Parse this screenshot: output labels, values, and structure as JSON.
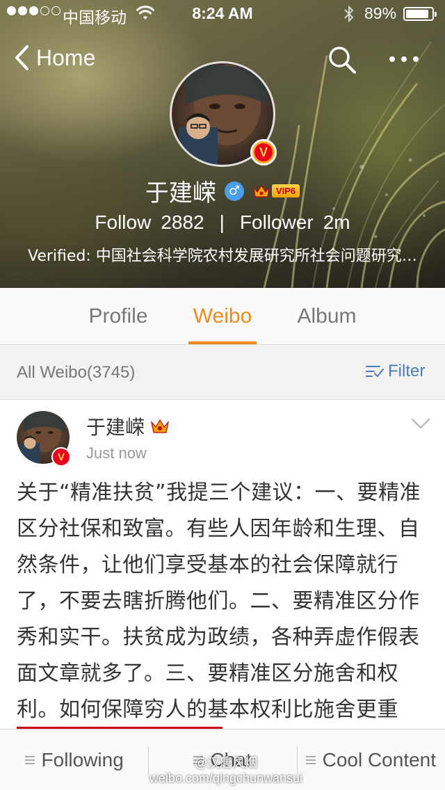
{
  "status_bar": {
    "carrier": "中国移动",
    "time": "8:24 AM",
    "battery": "89%",
    "battery_level": 0.89,
    "signal_full": 3,
    "signal_total": 5
  },
  "nav": {
    "back_label": "Home",
    "back_icon": "chevron-left-icon",
    "search_icon": "search-icon",
    "more_icon": "more-horizontal-icon"
  },
  "profile": {
    "name": "于建嵘",
    "gender_symbol": "♂",
    "vip_label": "VIP6",
    "verified_badge": "V",
    "follow_label": "Follow",
    "follow_count": "2882",
    "separator": "|",
    "follower_label": "Follower",
    "follower_count": "2m",
    "verified_text": "Verified: 中国社会科学院农村发展研究所社会问题研究中心主任"
  },
  "tabs": [
    {
      "label": "Profile",
      "active": false
    },
    {
      "label": "Weibo",
      "active": true
    },
    {
      "label": "Album",
      "active": false
    }
  ],
  "filter_bar": {
    "all_weibo": "All Weibo(3745)",
    "filter_label": "Filter"
  },
  "post": {
    "author": "于建嵘",
    "time": "Just now",
    "verified_badge": "V",
    "text": "关于“精准扶贫”我提三个建议：一、要精准区分社保和致富。有些人因年龄和生理、自然条件，让他们享受基本的社会保障就行了，不要去瞎折腾他们。二、要精准区分作秀和实干。扶贫成为政绩，各种弄虚作假表面文章就多了。三、要精准区分施舍和权利。如何保障穷人的基本权利比施舍更重要。"
  },
  "bottom_bar": [
    {
      "label": "Following"
    },
    {
      "label": "Chat"
    },
    {
      "label": "Cool Content"
    }
  ],
  "watermark": {
    "line1": "@汉唐风烟",
    "line2": "weibo.com/qingchunwansui"
  },
  "colors": {
    "accent": "#ef8a1e",
    "link": "#4c7cb6",
    "verified_red": "#e8001c",
    "vip_gold": "#f5a300",
    "gender_blue": "#4a9de8"
  }
}
